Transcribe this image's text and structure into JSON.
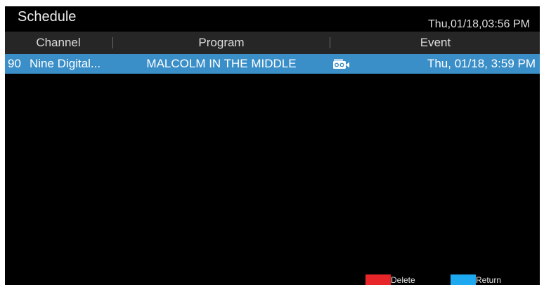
{
  "title": "Schedule",
  "clock": "Thu,01/18,03:56 PM",
  "columns": {
    "channel": "Channel",
    "program": "Program",
    "event": "Event"
  },
  "rows": [
    {
      "number": "90",
      "channel": "Nine Digital...",
      "program": "MALCOLM IN THE MIDDLE",
      "event_icon": "record-icon",
      "event": "Thu, 01/18, 3:59 PM"
    }
  ],
  "legend": {
    "delete": {
      "color": "#e8262a",
      "label": "Delete"
    },
    "return": {
      "color": "#1ea8ef",
      "label": "Return"
    }
  },
  "colors": {
    "background": "#000000",
    "header_bar": "#262626",
    "selected_row": "#3b8fc8"
  }
}
